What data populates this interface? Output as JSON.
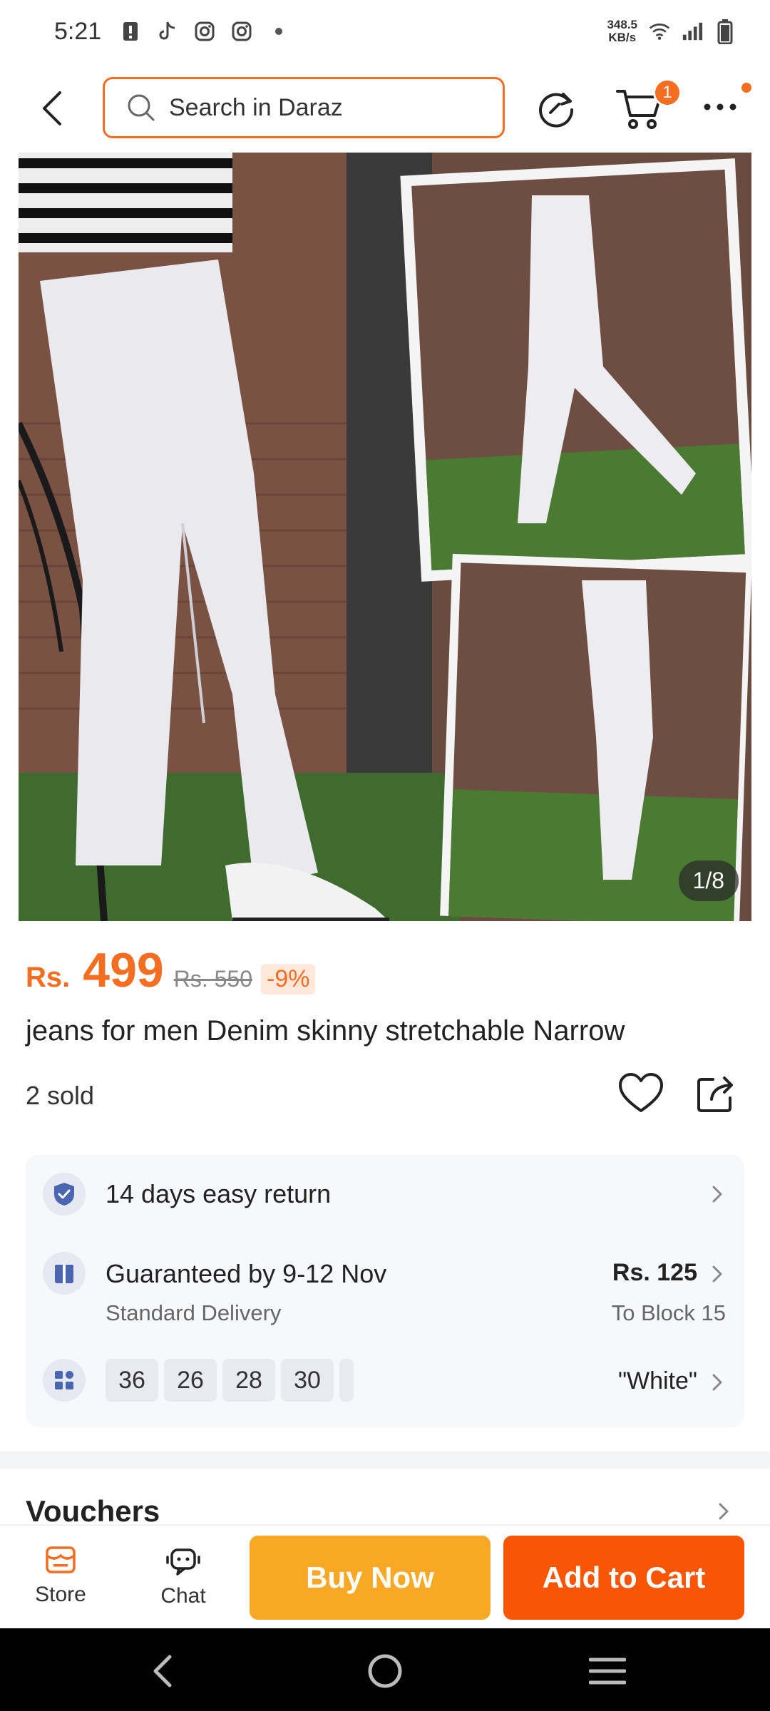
{
  "status_bar": {
    "time": "5:21",
    "speed_value": "348.5",
    "speed_unit": "KB/s",
    "icons": [
      "alert-icon",
      "tiktok-icon",
      "instagram-icon",
      "instagram-icon",
      "dot-icon",
      "wifi-icon",
      "signal-icon",
      "battery-icon"
    ]
  },
  "topbar": {
    "search_placeholder": "Search in Daraz",
    "cart_count": "1"
  },
  "gallery": {
    "counter": "1/8"
  },
  "product": {
    "currency": "Rs.",
    "price": "499",
    "old_price": "Rs. 550",
    "discount": "-9%",
    "title": "jeans for men Denim skinny stretchable Narrow",
    "sold": "2 sold"
  },
  "info": {
    "return_text": "14 days easy return",
    "delivery_text": "Guaranteed by 9-12 Nov",
    "delivery_sub": "Standard Delivery",
    "delivery_price": "Rs. 125",
    "delivery_location": "To Block 15",
    "sizes": [
      "36",
      "26",
      "28",
      "30"
    ],
    "color": "\"White\""
  },
  "vouchers": {
    "title": "Vouchers"
  },
  "action_bar": {
    "store_label": "Store",
    "chat_label": "Chat",
    "buy_now_label": "Buy Now",
    "add_to_cart_label": "Add to Cart"
  },
  "colors": {
    "accent": "#f36e21",
    "buy_now": "#f9a825",
    "add_to_cart": "#f85606"
  }
}
